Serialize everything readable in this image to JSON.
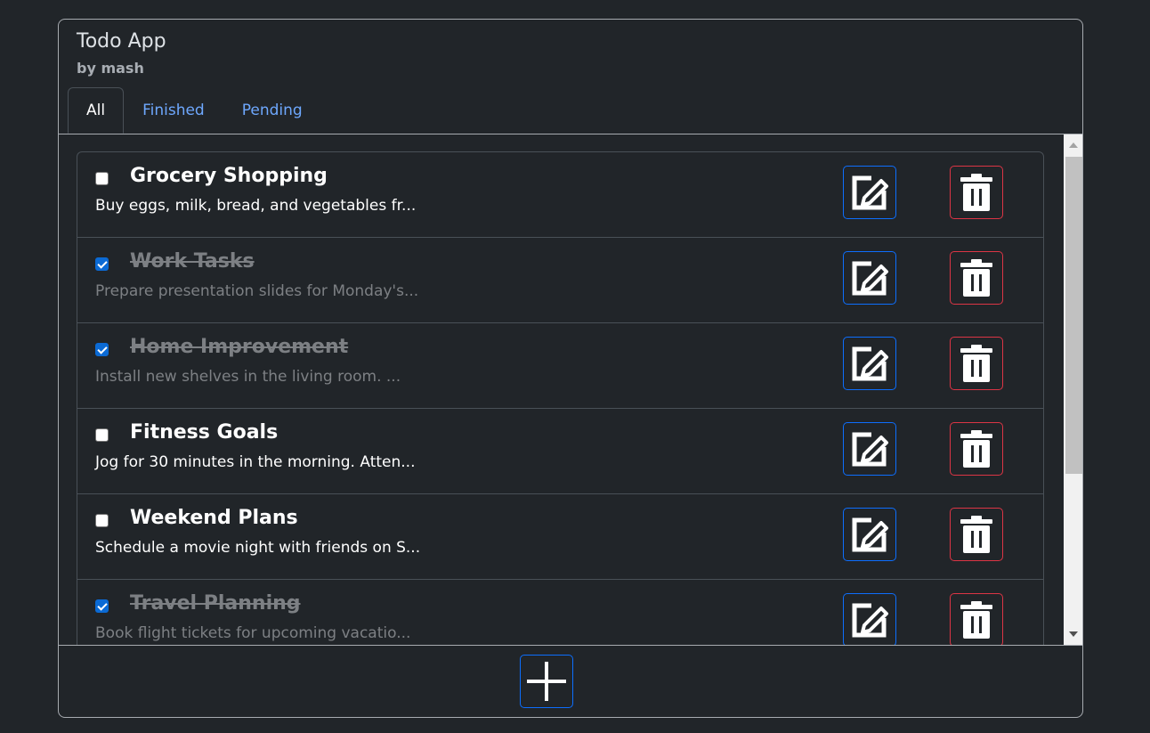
{
  "app": {
    "title": "Todo App",
    "subtitle": "by mash"
  },
  "tabs": [
    {
      "label": "All",
      "active": true
    },
    {
      "label": "Finished",
      "active": false
    },
    {
      "label": "Pending",
      "active": false
    }
  ],
  "todos": [
    {
      "title": "Grocery Shopping",
      "description": "Buy eggs, milk, bread, and vegetables fr...",
      "done": false
    },
    {
      "title": "Work Tasks",
      "description": "Prepare presentation slides for Monday's...",
      "done": true
    },
    {
      "title": "Home Improvement",
      "description": "Install new shelves in the living room. ...",
      "done": true
    },
    {
      "title": "Fitness Goals",
      "description": "Jog for 30 minutes in the morning. Atten...",
      "done": false
    },
    {
      "title": "Weekend Plans",
      "description": "Schedule a movie night with friends on S...",
      "done": false
    },
    {
      "title": "Travel Planning",
      "description": "Book flight tickets for upcoming vacatio...",
      "done": true
    }
  ],
  "icons": {
    "edit": "edit-icon",
    "delete": "trash-icon",
    "add": "plus-icon"
  },
  "colors": {
    "background": "#212529",
    "accent_blue": "#0d6efd",
    "danger_red": "#dc3545",
    "link_blue": "#6ea8fe",
    "muted_text": "#7d8084"
  }
}
